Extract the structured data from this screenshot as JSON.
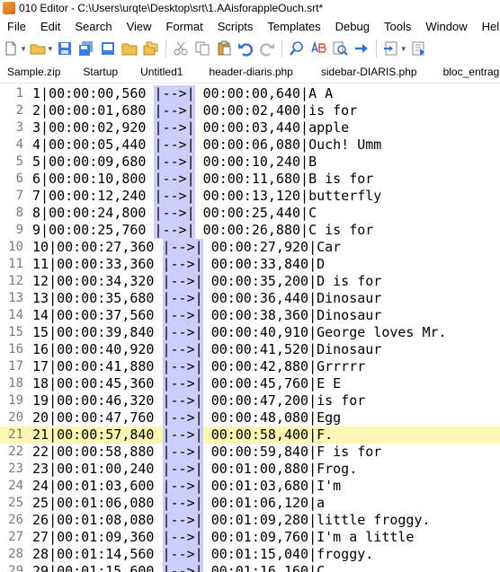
{
  "window": {
    "title": "010 Editor - C:\\Users\\urqte\\Desktop\\srt\\1.AAisforappleOuch.srt*"
  },
  "menu": [
    "File",
    "Edit",
    "Search",
    "View",
    "Format",
    "Scripts",
    "Templates",
    "Debug",
    "Tools",
    "Window",
    "Help"
  ],
  "tabs": [
    "Sample.zip",
    "Startup",
    "Untitled1",
    "header-diaris.php",
    "sidebar-DIARIS.php",
    "bloc_entrag"
  ],
  "editor": {
    "current_line": 21,
    "lines": [
      {
        "num": "1",
        "idx": " 1",
        "start": "00:00:00,560",
        "end": "00:00:00,640",
        "text": "A A"
      },
      {
        "num": "2",
        "idx": " 2",
        "start": "00:00:01,680",
        "end": "00:00:02,400",
        "text": "is for"
      },
      {
        "num": "3",
        "idx": " 3",
        "start": "00:00:02,920",
        "end": "00:00:03,440",
        "text": "apple"
      },
      {
        "num": "4",
        "idx": " 4",
        "start": "00:00:05,440",
        "end": "00:00:06,080",
        "text": "Ouch! Umm"
      },
      {
        "num": "5",
        "idx": " 5",
        "start": "00:00:09,680",
        "end": "00:00:10,240",
        "text": "B"
      },
      {
        "num": "6",
        "idx": " 6",
        "start": "00:00:10,800",
        "end": "00:00:11,680",
        "text": "B is for"
      },
      {
        "num": "7",
        "idx": " 7",
        "start": "00:00:12,240",
        "end": "00:00:13,120",
        "text": "butterfly"
      },
      {
        "num": "8",
        "idx": " 8",
        "start": "00:00:24,800",
        "end": "00:00:25,440",
        "text": "C"
      },
      {
        "num": "9",
        "idx": " 9",
        "start": "00:00:25,760",
        "end": "00:00:26,880",
        "text": "C is for"
      },
      {
        "num": "10",
        "idx": "10",
        "start": "00:00:27,360",
        "end": "00:00:27,920",
        "text": "Car"
      },
      {
        "num": "11",
        "idx": "11",
        "start": "00:00:33,360",
        "end": "00:00:33,840",
        "text": "D"
      },
      {
        "num": "12",
        "idx": "12",
        "start": "00:00:34,320",
        "end": "00:00:35,200",
        "text": "D is for"
      },
      {
        "num": "13",
        "idx": "13",
        "start": "00:00:35,680",
        "end": "00:00:36,440",
        "text": "Dinosaur"
      },
      {
        "num": "14",
        "idx": "14",
        "start": "00:00:37,560",
        "end": "00:00:38,360",
        "text": "Dinosaur"
      },
      {
        "num": "15",
        "idx": "15",
        "start": "00:00:39,840",
        "end": "00:00:40,910",
        "text": "George loves Mr."
      },
      {
        "num": "16",
        "idx": "16",
        "start": "00:00:40,920",
        "end": "00:00:41,520",
        "text": "Dinosaur"
      },
      {
        "num": "17",
        "idx": "17",
        "start": "00:00:41,880",
        "end": "00:00:42,880",
        "text": "Grrrrr"
      },
      {
        "num": "18",
        "idx": "18",
        "start": "00:00:45,360",
        "end": "00:00:45,760",
        "text": "E E"
      },
      {
        "num": "19",
        "idx": "19",
        "start": "00:00:46,320",
        "end": "00:00:47,200",
        "text": "is for"
      },
      {
        "num": "20",
        "idx": "20",
        "start": "00:00:47,760",
        "end": "00:00:48,080",
        "text": "Egg"
      },
      {
        "num": "21",
        "idx": "21",
        "start": "00:00:57,840",
        "end": "00:00:58,400",
        "text": "F."
      },
      {
        "num": "22",
        "idx": "22",
        "start": "00:00:58,880",
        "end": "00:00:59,840",
        "text": "F is for"
      },
      {
        "num": "23",
        "idx": "23",
        "start": "00:01:00,240",
        "end": "00:01:00,880",
        "text": "Frog."
      },
      {
        "num": "24",
        "idx": "24",
        "start": "00:01:03,600",
        "end": "00:01:03,680",
        "text": "I'm"
      },
      {
        "num": "25",
        "idx": "25",
        "start": "00:01:06,080",
        "end": "00:01:06,120",
        "text": "a"
      },
      {
        "num": "26",
        "idx": "26",
        "start": "00:01:08,080",
        "end": "00:01:09,280",
        "text": "little froggy."
      },
      {
        "num": "27",
        "idx": "27",
        "start": "00:01:09,360",
        "end": "00:01:09,760",
        "text": "I'm a little"
      },
      {
        "num": "28",
        "idx": "28",
        "start": "00:01:14,560",
        "end": "00:01:15,040",
        "text": "froggy."
      },
      {
        "num": "29",
        "idx": "29",
        "start": "00:01:15,600",
        "end": "00:01:16,160",
        "text": "C"
      }
    ]
  }
}
